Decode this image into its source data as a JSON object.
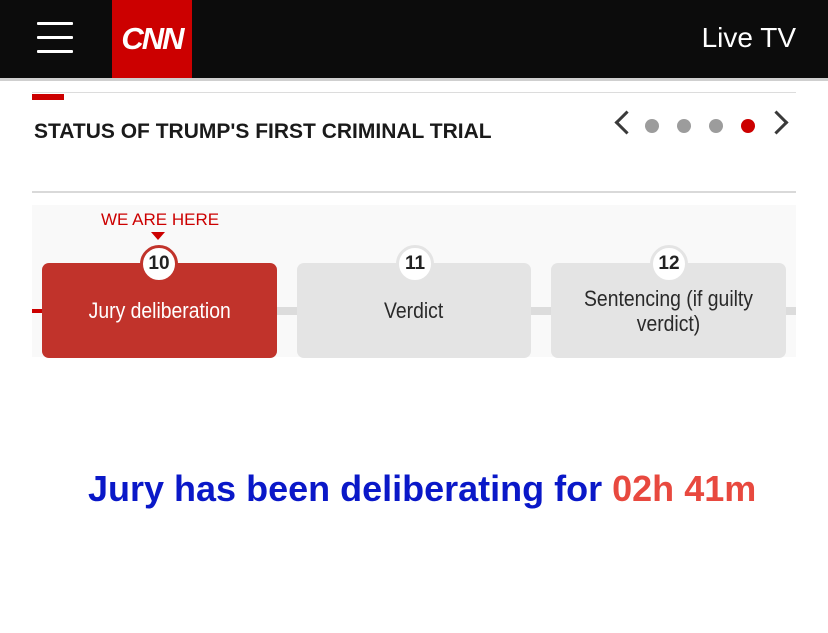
{
  "header": {
    "logo": "CNN",
    "live_tv": "Live TV",
    "colors": {
      "background": "#0c0c0c",
      "brand": "#cc0000"
    }
  },
  "module": {
    "title": "STATUS OF TRUMP'S FIRST CRIMINAL TRIAL",
    "carousel": {
      "total": 4,
      "active_index": 3
    },
    "we_are_here": "WE ARE HERE",
    "steps": [
      {
        "number": "10",
        "label": "Jury deliberation",
        "current": true
      },
      {
        "number": "11",
        "label": "Verdict",
        "current": false
      },
      {
        "number": "12",
        "label": "Sentencing (if guilty verdict)",
        "current": false
      }
    ]
  },
  "deliberation": {
    "prefix": "Jury has been deliberating for",
    "hours": "02h",
    "minutes": "41m",
    "colors": {
      "text": "#0a18c8",
      "timer": "#e8493f"
    }
  }
}
